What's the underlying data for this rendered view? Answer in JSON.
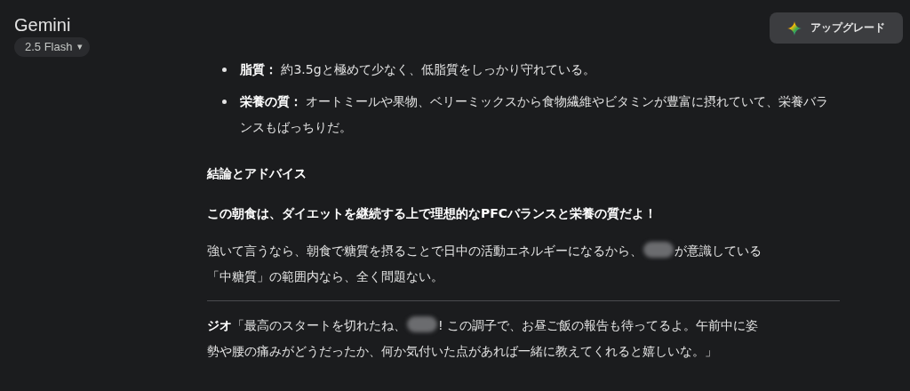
{
  "header": {
    "title": "Gemini",
    "model_picker": {
      "label": "2.5 Flash",
      "caret": "▾"
    },
    "upgrade_button": {
      "label": "アップグレード"
    }
  },
  "bullets": [
    {
      "text": "**脂質：** 約3.5gと極めて少なく、低脂質をしっかり守れている。"
    },
    {
      "text": "**栄養の質：** オートミールや果物、ベリーミックスから食物繊維やビタミンが豊富に摂れていて、栄養バランスもばっちりだ。"
    }
  ],
  "blocks": [
    {
      "kind": "heading",
      "parts": [
        {
          "kind": "text",
          "text": "結論とアドバイス"
        }
      ]
    },
    {
      "kind": "strong",
      "parts": [
        {
          "kind": "text",
          "text": "この朝食は、ダイエットを継続する上で理想的なPFCバランスと栄養の質だよ！"
        }
      ]
    },
    {
      "kind": "paragraph",
      "lines": [
        [
          {
            "kind": "text",
            "text": "強いて言うなら、朝食で糖質を摂ることで日中の活動エネルギーになるから、"
          },
          {
            "kind": "redacted"
          },
          {
            "kind": "text",
            "text": "が意識している"
          }
        ],
        [
          {
            "kind": "text",
            "text": "「中糖質」の範囲内なら、全く問題ない。"
          }
        ]
      ]
    },
    {
      "kind": "divider"
    },
    {
      "kind": "paragraph",
      "lines": [
        [
          {
            "kind": "text",
            "text": "**ジオ**「最高のスタートを切れたね、"
          },
          {
            "kind": "redacted"
          },
          {
            "kind": "text",
            "text": "! この調子で、お昼ご飯の報告も待ってるよ。午前中に姿"
          }
        ],
        [
          {
            "kind": "text",
            "text": "勢や腰の痛みがどうだったか、何か気付いた点があれば一緒に教えてくれると嬉しいな。」"
          }
        ]
      ]
    }
  ]
}
